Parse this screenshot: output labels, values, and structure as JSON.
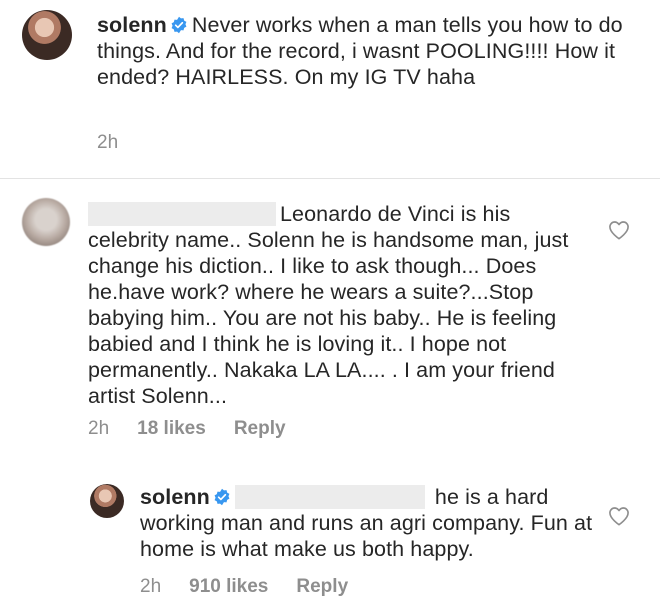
{
  "post": {
    "username": "solenn",
    "caption": "Never works when a man tells you how to do things. And for the record, i wasnt POOLING!!!! How it ended? HAIRLESS. On my IG TV haha",
    "time": "2h"
  },
  "comment1": {
    "text_prefix": "Leonardo de Vinci is his celebrity name.. Solenn he is handsome man, just change his diction.. I like to ask though... Does he.have work?  where he wears a suite?...Stop babying him.. You are not his baby.. He is feeling babied and I think he is loving it.. I hope not permanently.. Nakaka LA LA.... . I am your friend artist Solenn...",
    "time": "2h",
    "likes": "18 likes",
    "reply": "Reply"
  },
  "reply1": {
    "username": "solenn",
    "text": "he is a hard working man and runs an agri company. Fun at home is what make us both happy.",
    "time": "2h",
    "likes": "910 likes",
    "reply": "Reply"
  },
  "icons": {
    "verified": "verified-badge-icon",
    "heart": "heart-outline-icon"
  },
  "colors": {
    "verified": "#3897f0",
    "meta": "#8e8e8e",
    "text": "#262626"
  }
}
